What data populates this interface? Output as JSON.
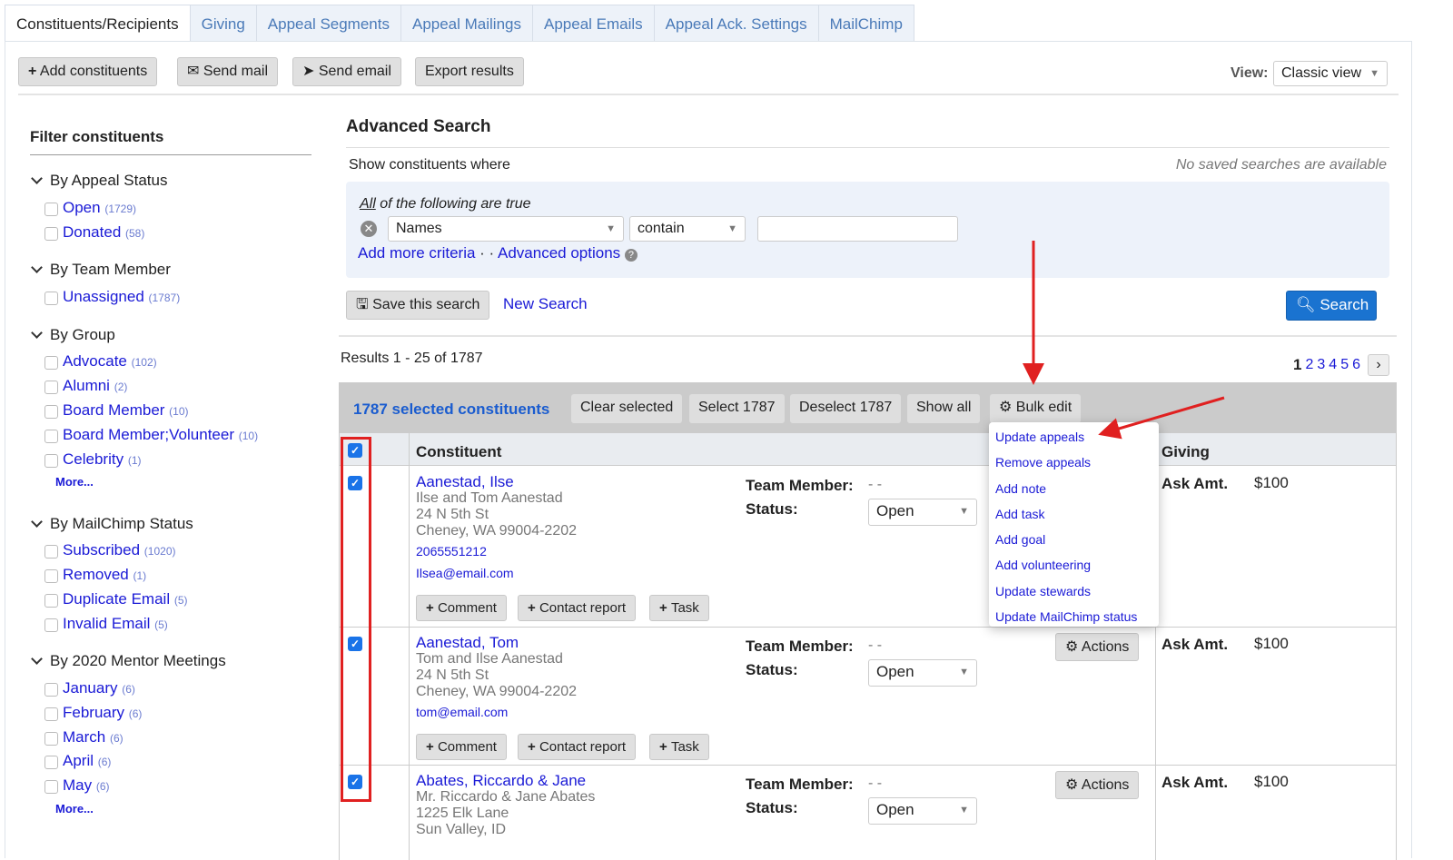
{
  "tabs": [
    "Constituents/Recipients",
    "Giving",
    "Appeal Segments",
    "Appeal Mailings",
    "Appeal Emails",
    "Appeal Ack. Settings",
    "MailChimp"
  ],
  "toolbar": {
    "add": "Add constituents",
    "mail": "Send mail",
    "email": "Send email",
    "export": "Export results",
    "view_label": "View:",
    "view_value": "Classic view"
  },
  "sidebar": {
    "title": "Filter constituents",
    "more": "More...",
    "groups": [
      {
        "title": "By Appeal Status",
        "items": [
          {
            "label": "Open",
            "count": "(1729)"
          },
          {
            "label": "Donated",
            "count": "(58)"
          }
        ]
      },
      {
        "title": "By Team Member",
        "items": [
          {
            "label": "Unassigned",
            "count": "(1787)"
          }
        ]
      },
      {
        "title": "By Group",
        "items": [
          {
            "label": "Advocate",
            "count": "(102)"
          },
          {
            "label": "Alumni",
            "count": "(2)"
          },
          {
            "label": "Board Member",
            "count": "(10)"
          },
          {
            "label": "Board Member;Volunteer",
            "count": "(10)"
          },
          {
            "label": "Celebrity",
            "count": "(1)"
          }
        ]
      },
      {
        "title": "By MailChimp Status",
        "items": [
          {
            "label": "Subscribed",
            "count": "(1020)"
          },
          {
            "label": "Removed",
            "count": "(1)"
          },
          {
            "label": "Duplicate Email",
            "count": "(5)"
          },
          {
            "label": "Invalid Email",
            "count": "(5)"
          }
        ]
      },
      {
        "title": "By 2020 Mentor Meetings",
        "items": [
          {
            "label": "January",
            "count": "(6)"
          },
          {
            "label": "February",
            "count": "(6)"
          },
          {
            "label": "March",
            "count": "(6)"
          },
          {
            "label": "April",
            "count": "(6)"
          },
          {
            "label": "May",
            "count": "(6)"
          }
        ]
      }
    ]
  },
  "search": {
    "title": "Advanced Search",
    "show": "Show constituents where",
    "no_saved": "No saved searches are available",
    "all_word": "All",
    "all_rest": " of the following are true",
    "field": "Names",
    "op": "contain",
    "value": "",
    "add_more": "Add more criteria",
    "sep": " · · ",
    "advanced": "Advanced options",
    "save": "Save this search",
    "new": "New Search",
    "search_btn": "Search"
  },
  "results": {
    "summary": "Results 1 - 25 of 1787",
    "pages": [
      "1",
      "2",
      "3",
      "4",
      "5",
      "6"
    ],
    "current_page": "1"
  },
  "bulk": {
    "selected": "1787 selected constituents",
    "clear": "Clear selected",
    "select": "Select 1787",
    "deselect": "Deselect 1787",
    "show_all": "Show all",
    "bulk_edit": "Bulk edit",
    "menu": [
      "Update appeals",
      "Remove appeals",
      "Add note",
      "Add task",
      "Add goal",
      "Add volunteering",
      "Update stewards",
      "Update MailChimp status"
    ]
  },
  "table": {
    "col_constituent": "Constituent",
    "col_giving": "Giving",
    "team_label": "Team Member:",
    "status_label": "Status:",
    "ask_label": "Ask Amt.",
    "comment": "Comment",
    "contact": "Contact report",
    "task": "Task",
    "actions": "Actions",
    "rows": [
      {
        "name": "Aanestad, Ilse",
        "lines": [
          "Ilse and Tom Aanestad",
          "24 N 5th St",
          "Cheney, WA 99004-2202"
        ],
        "phone": "2065551212",
        "email": "Ilsea@email.com",
        "team": "- -",
        "status": "Open",
        "ask": "$100",
        "checked": true
      },
      {
        "name": "Aanestad, Tom",
        "lines": [
          "Tom and Ilse Aanestad",
          "24 N 5th St",
          "Cheney, WA 99004-2202"
        ],
        "email": "tom@email.com",
        "team": "- -",
        "status": "Open",
        "ask": "$100",
        "checked": true
      },
      {
        "name": "Abates, Riccardo & Jane",
        "lines": [
          "Mr. Riccardo & Jane Abates",
          "1225 Elk Lane",
          "Sun Valley, ID"
        ],
        "team": "- -",
        "status": "Open",
        "ask": "$100",
        "checked": true
      }
    ]
  },
  "colors": {
    "accent": "#1a73d0",
    "link": "#1a1ad6",
    "annotation": "#e02020"
  }
}
